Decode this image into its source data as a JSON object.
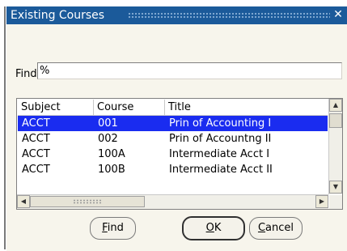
{
  "window": {
    "title": "Existing Courses",
    "close_glyph": "✕"
  },
  "find": {
    "label": "Find",
    "value": "%"
  },
  "columns": [
    "Subject",
    "Course",
    "Title"
  ],
  "rows": [
    {
      "subject": "ACCT",
      "course": "001",
      "title": "Prin of Accounting I",
      "selected": true
    },
    {
      "subject": "ACCT",
      "course": "002",
      "title": "Prin of Accountng II",
      "selected": false
    },
    {
      "subject": "ACCT",
      "course": "100A",
      "title": "Intermediate Acct I",
      "selected": false
    },
    {
      "subject": "ACCT",
      "course": "100B",
      "title": "Intermediate Acct II",
      "selected": false
    }
  ],
  "buttons": {
    "find": {
      "label": "Find",
      "mnemonic": "F"
    },
    "ok": {
      "label": "OK",
      "mnemonic": "O"
    },
    "cancel": {
      "label": "Cancel",
      "mnemonic": "C"
    }
  },
  "colors": {
    "titlebar": "#1b5a9a",
    "selection": "#1a2cf0",
    "dialog_bg": "#f7f5ec"
  }
}
